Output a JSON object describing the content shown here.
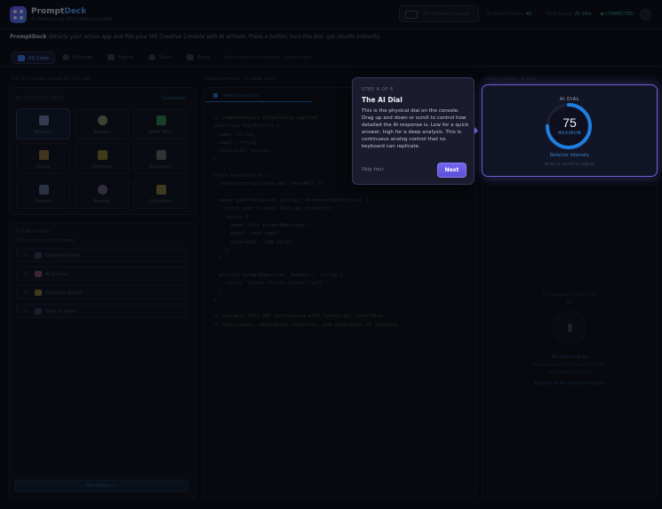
{
  "app": {
    "name_prefix": "Prompt",
    "name_accent": "Deck",
    "subtitle": "AI shortcuts for MX Creative Console"
  },
  "header": {
    "console_button": "MX Creative Console",
    "stat_actions_label": "AI Actions Today:",
    "stat_actions_value": "48",
    "stat_saved_label": "Time Saved:",
    "stat_saved_value": "2h 14m",
    "connection": "CONNECTED"
  },
  "intro": {
    "brand": "PromptDeck",
    "text": "detects your active app and fills your MX Creative Console with AI actions. Press a button, turn the dial, get results instantly."
  },
  "tabs": [
    {
      "label": "VS Code",
      "icon": "code-icon",
      "active": true
    },
    {
      "label": "Browser",
      "icon": "globe-icon",
      "active": false
    },
    {
      "label": "Figma",
      "icon": "pen-icon",
      "active": false
    },
    {
      "label": "Slack",
      "icon": "chat-icon",
      "active": false
    },
    {
      "label": "Excel",
      "icon": "sheet-icon",
      "active": false
    }
  ],
  "tab_hint": "Active app auto-detected · Switch apps",
  "left": {
    "heading": "Your 3×3 button layout for VS Code",
    "keys_title": "AI CONSOLE KEYS",
    "keys_action": "Customize",
    "keys": [
      {
        "label": "Refactor",
        "icon": "refactor-icon",
        "color": "#6f7fa8"
      },
      {
        "label": "Explain",
        "icon": "bulb-icon",
        "color": "#8a8a6a"
      },
      {
        "label": "Write Tests",
        "icon": "check-icon",
        "color": "#2d8a4e"
      },
      {
        "label": "Debug",
        "icon": "bug-icon",
        "color": "#8a6f3a"
      },
      {
        "label": "Optimize",
        "icon": "bolt-icon",
        "color": "#8a7a2a"
      },
      {
        "label": "Document",
        "icon": "doc-icon",
        "color": "#6a6a6a"
      },
      {
        "label": "Convert",
        "icon": "convert-icon",
        "color": "#5a6a8a"
      },
      {
        "label": "Review",
        "icon": "eye-icon",
        "color": "#6a5a7a"
      },
      {
        "label": "Complete",
        "icon": "sparkle-icon",
        "color": "#8a7a3a"
      }
    ],
    "flow_title": "FLOW CHAIN",
    "flow_sub": "Chain actions in one press",
    "flow_steps": [
      {
        "n": "1",
        "label": "Capture Screen",
        "icon": "camera-icon"
      },
      {
        "n": "2",
        "label": "AI Analyze",
        "icon": "brain-icon"
      },
      {
        "label": "Generate Report",
        "n": "3",
        "icon": "report-icon"
      },
      {
        "n": "4",
        "label": "Send to Slack",
        "icon": "send-icon"
      }
    ],
    "run_button": "Run chain ⟶"
  },
  "editor": {
    "heading": "Output preview · AI result inline",
    "file_tab": "refactor-result.ts",
    "lines": [
      {
        "t": "// Comprehensive refactoring applied",
        "c": true
      },
      {
        "t": "interface UserProfile {",
        "c": false
      },
      {
        "t": "  name: string;",
        "c": false
      },
      {
        "t": "  email: string;",
        "c": false
      },
      {
        "t": "  displayId: string;",
        "c": false
      },
      {
        "t": "}",
        "c": false
      },
      {
        "t": "",
        "c": false
      },
      {
        "t": "class UserService {",
        "c": false
      },
      {
        "t": "  constructor(private api: UserAPI) {}",
        "c": false
      },
      {
        "t": "",
        "c": false
      },
      {
        "t": "  async getProfile(id: string): Promise<UserProfile> {",
        "c": false
      },
      {
        "t": "    const user = await this.api.fetch(id);",
        "c": false
      },
      {
        "t": "    return {",
        "c": false
      },
      {
        "t": "      name: this.formatName(user),",
        "c": false
      },
      {
        "t": "      email: user.email,",
        "c": false
      },
      {
        "t": "      displayId: `USR-${id}`",
        "c": false
      },
      {
        "t": "    };",
        "c": false
      },
      {
        "t": "  }",
        "c": false
      },
      {
        "t": "",
        "c": false
      },
      {
        "t": "  private formatName(user: RawUser): string {",
        "c": false
      },
      {
        "t": "    return `${user.first} ${user.last}`;",
        "c": false
      },
      {
        "t": "  }",
        "c": false
      },
      {
        "t": "}",
        "c": false
      },
      {
        "t": "",
        "c": false
      },
      {
        "t": "// Changes: Full OOP restructure with TypeScript interfaces,",
        "c": true
      },
      {
        "t": "// async/await, dependency injection, and separation of concerns",
        "c": true
      }
    ]
  },
  "dial": {
    "heading": "Analog control · AI Dial",
    "label": "AI DIAL",
    "value": "75",
    "mode": "MAXIMUM",
    "level_fraction": 0.75,
    "caption": "Refactor intensity",
    "hint": "drag or scroll to adjust"
  },
  "right": {
    "line1": "No captured outputs yet",
    "line2": "Idle",
    "status": "No feature drag",
    "desc1": "Press any button, twist the knob,",
    "desc2": "to trigger an action",
    "link": "Activate all MX Console features"
  },
  "tour": {
    "step": "STEP 4 OF 6",
    "title": "The AI Dial",
    "body": "This is the physical dial on the console. Drag up and down or scroll to control how detailed the AI response is. Low for a quick answer, high for a deep analysis. This is continuous analog control that no keyboard can replicate.",
    "skip": "Skip tour",
    "next": "Next"
  },
  "colors": {
    "accent": "#5fa3ff",
    "tour_primary": "#6c62d8",
    "dial_arc": "#1f7fe0",
    "connected": "#2fb26c"
  }
}
